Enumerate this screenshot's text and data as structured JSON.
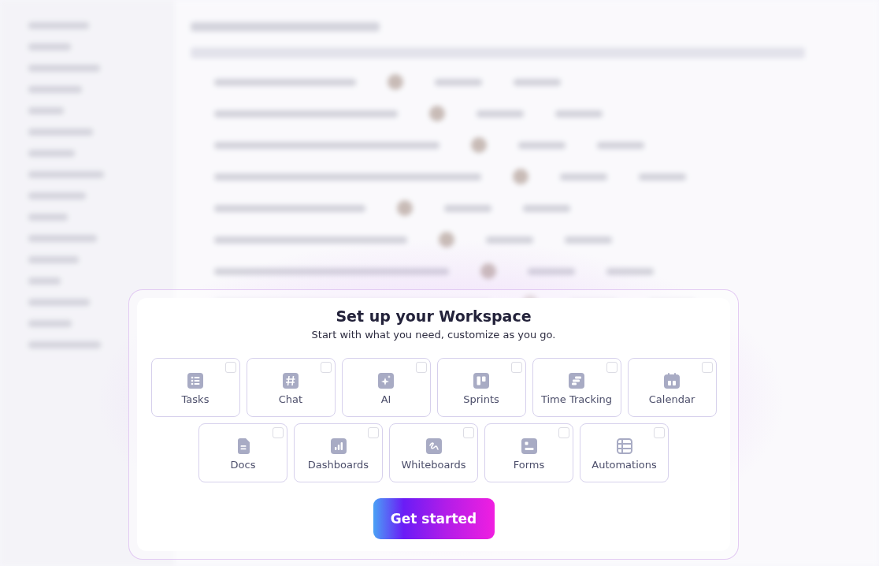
{
  "dialog": {
    "title": "Set up your Workspace",
    "subtitle": "Start with what you need, customize as you go.",
    "options": [
      {
        "label": "Tasks",
        "kind": "list",
        "checked": false
      },
      {
        "label": "Chat",
        "kind": "hash",
        "checked": false
      },
      {
        "label": "AI",
        "kind": "sparkle",
        "checked": false
      },
      {
        "label": "Sprints",
        "kind": "board",
        "checked": false
      },
      {
        "label": "Time Tracking",
        "kind": "bars",
        "checked": false
      },
      {
        "label": "Calendar",
        "kind": "calendar",
        "checked": false
      },
      {
        "label": "Docs",
        "kind": "doc",
        "checked": false
      },
      {
        "label": "Dashboards",
        "kind": "chart",
        "checked": false
      },
      {
        "label": "Whiteboards",
        "kind": "scribble",
        "checked": false
      },
      {
        "label": "Forms",
        "kind": "form",
        "checked": false
      },
      {
        "label": "Automations",
        "kind": "table",
        "checked": false
      }
    ],
    "button": "Get started"
  }
}
